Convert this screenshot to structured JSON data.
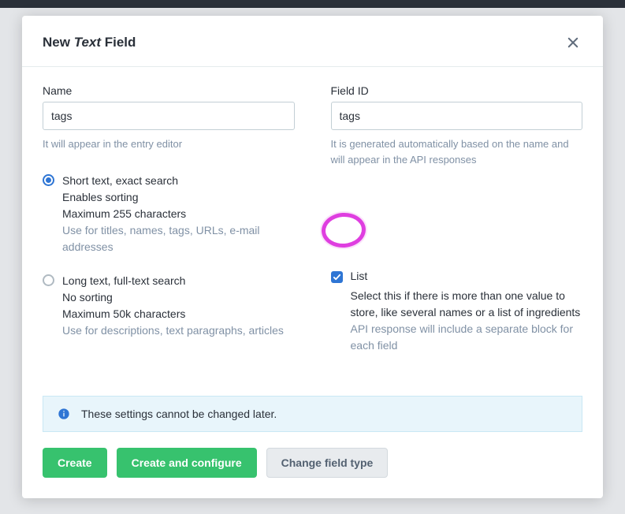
{
  "modal": {
    "title_pre": "New ",
    "title_em": "Text",
    "title_post": " Field"
  },
  "left": {
    "name_label": "Name",
    "name_value": "tags",
    "name_help": "It will appear in the entry editor"
  },
  "right": {
    "fieldid_label": "Field ID",
    "fieldid_value": "tags",
    "fieldid_help": "It is generated automatically based on the name and will appear in the API responses"
  },
  "options": {
    "short": {
      "title": "Short text, exact search",
      "line1": "Enables sorting",
      "line2": "Maximum 255 characters",
      "sub": "Use for titles, names, tags, URLs, e-mail addresses",
      "checked": true
    },
    "long": {
      "title": "Long text, full-text search",
      "line1": "No sorting",
      "line2": "Maximum 50k characters",
      "sub": "Use for descriptions, text paragraphs, articles",
      "checked": false
    }
  },
  "list": {
    "label": "List",
    "desc1": "Select this if there is more than one value to store, like several names or a list of ingredients",
    "desc2": "API response will include a separate block for each field",
    "checked": true
  },
  "banner": {
    "text": "These settings cannot be changed later."
  },
  "buttons": {
    "create": "Create",
    "create_configure": "Create and configure",
    "change_type": "Change field type"
  }
}
